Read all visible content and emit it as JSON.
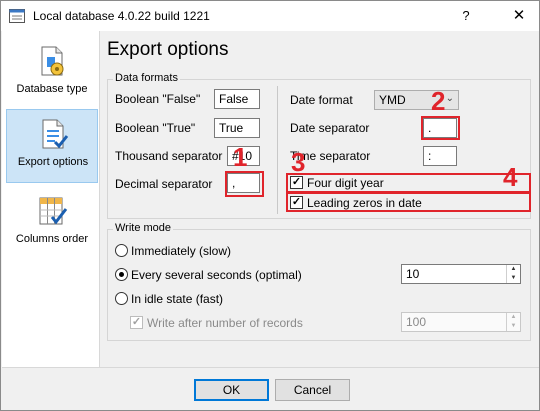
{
  "window": {
    "title": "Local database 4.0.22 build 1221",
    "help_glyph": "?",
    "close_glyph": "✕"
  },
  "sidebar": {
    "items": [
      {
        "label": "Database type",
        "icon": "database-type-icon",
        "active": false
      },
      {
        "label": "Export options",
        "icon": "export-options-icon",
        "active": true
      },
      {
        "label": "Columns order",
        "icon": "columns-order-icon",
        "active": false
      }
    ]
  },
  "main": {
    "heading": "Export options",
    "data_formats": {
      "legend": "Data formats",
      "boolean_false": {
        "label": "Boolean \"False\"",
        "value": "False"
      },
      "boolean_true": {
        "label": "Boolean \"True\"",
        "value": "True"
      },
      "thousand_separator": {
        "label": "Thousand separator",
        "value": "#10"
      },
      "decimal_separator": {
        "label": "Decimal separator",
        "value": ","
      },
      "date_format": {
        "label": "Date format",
        "value": "YMD"
      },
      "date_separator": {
        "label": "Date separator",
        "value": "."
      },
      "time_separator": {
        "label": "Time separator",
        "value": ":"
      },
      "four_digit_year": {
        "label": "Four digit year",
        "checked": true
      },
      "leading_zeros": {
        "label": "Leading zeros in date",
        "checked": true
      }
    },
    "write_mode": {
      "legend": "Write mode",
      "immediately": {
        "label": "Immediately (slow)",
        "selected": false
      },
      "every_several": {
        "label": "Every several seconds (optimal)",
        "selected": true,
        "value": "10"
      },
      "idle_state": {
        "label": "In idle state (fast)",
        "selected": false
      },
      "write_after_records": {
        "label": "Write after number of records",
        "checked": true,
        "enabled": false,
        "value": "100"
      }
    }
  },
  "annotations": [
    "1",
    "2",
    "3",
    "4"
  ],
  "annotation_color": "#e0242b",
  "footer": {
    "ok_label": "OK",
    "cancel_label": "Cancel"
  }
}
